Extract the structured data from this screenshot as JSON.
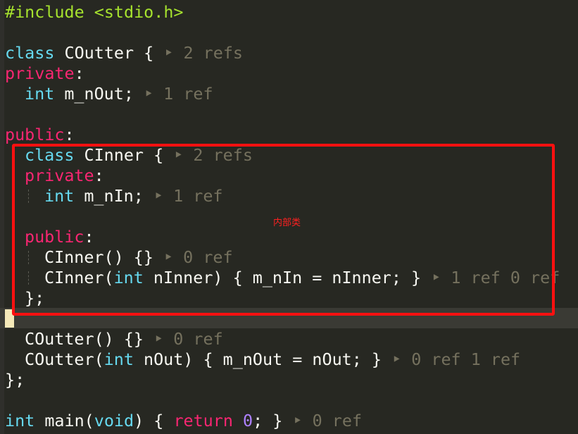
{
  "editor": {
    "lines": {
      "l01": "#include <stdio.h>",
      "l03": {
        "kw": "class",
        "name": " COutter {",
        "hint": " ‣ 2 refs"
      },
      "l04": {
        "kw": "private",
        "punct": ":"
      },
      "l05": {
        "type": "int",
        "name": " m_nOut;",
        "hint": " ‣ 1 ref"
      },
      "l07": {
        "kw": "public",
        "punct": ":"
      },
      "l08": {
        "kw": "class",
        "name": " CInner {",
        "hint": " ‣ 2 refs"
      },
      "l09": {
        "kw": "private",
        "punct": ":"
      },
      "l10": {
        "type": "int",
        "name": " m_nIn;",
        "hint": " ‣ 1 ref"
      },
      "l12": {
        "kw": "public",
        "punct": ":"
      },
      "l13": {
        "code": "CInner() {}",
        "hint": " ‣ 0 ref"
      },
      "l14": {
        "pre": "CInner(",
        "type": "int",
        "post": " nInner) { m_nIn = nInner; }",
        "hint": " ‣ 1 ref 0 ref"
      },
      "l15": "};",
      "l17": {
        "code": "COutter() {}",
        "hint": " ‣ 0 ref"
      },
      "l18": {
        "pre": "COutter(",
        "type": "int",
        "post": " nOut) { m_nOut = nOut; }",
        "hint": " ‣ 0 ref 1 ref"
      },
      "l19": "};",
      "l21": {
        "type": "int",
        "main": " main(",
        "void": "void",
        "brace": ") { ",
        "ret": "return",
        "sp": " ",
        "zero": "0",
        "end": "; }",
        "hint": " ‣ 0 ref"
      }
    },
    "annotation": {
      "label": "内部类",
      "color": "#ff1010"
    }
  }
}
